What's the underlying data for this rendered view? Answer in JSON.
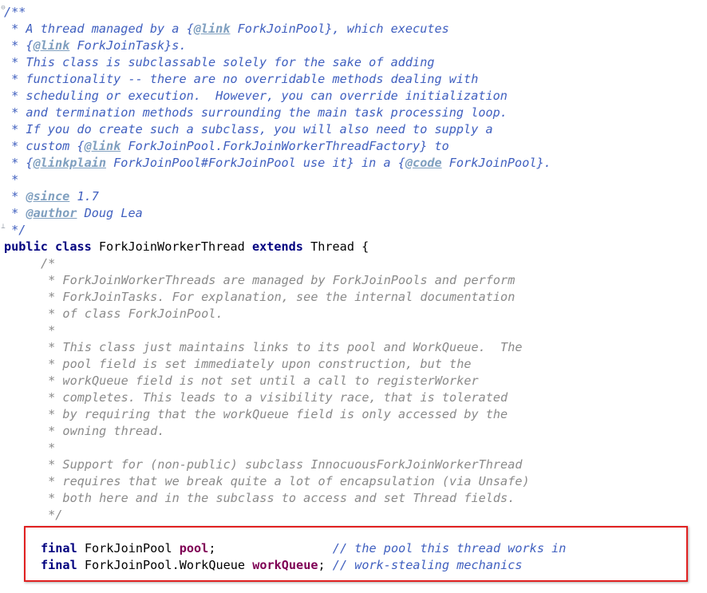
{
  "javadoc": {
    "open": "/**",
    "l1_a": " * A thread managed by a {",
    "l1_tag": "@link",
    "l1_b": " ForkJoinPool}, which executes",
    "l2_a": " * {",
    "l2_tag": "@link",
    "l2_b": " ForkJoinTask}s.",
    "l3": " * This class is subclassable solely for the sake of adding",
    "l4": " * functionality -- there are no overridable methods dealing with",
    "l5": " * scheduling or execution.  However, you can override initialization",
    "l6": " * and termination methods surrounding the main task processing loop.",
    "l7": " * If you do create such a subclass, you will also need to supply a",
    "l8_a": " * custom {",
    "l8_tag": "@link",
    "l8_b": " ForkJoinPool.ForkJoinWorkerThreadFactory} to",
    "l9_a": " * {",
    "l9_tag": "@linkplain",
    "l9_b": " ForkJoinPool#ForkJoinPool use it} in a {",
    "l9_tag2": "@code",
    "l9_c": " ForkJoinPool}.",
    "l10": " *",
    "l11_a": " * ",
    "l11_tag": "@since",
    "l11_b": " 1.7",
    "l12_a": " * ",
    "l12_tag": "@author",
    "l12_b": " Doug Lea",
    "close": " */"
  },
  "class_decl": {
    "kw_public": "public",
    "kw_class": "class",
    "name": "ForkJoinWorkerThread",
    "kw_extends": "extends",
    "super": "Thread {"
  },
  "block_comment": [
    "/*",
    " * ForkJoinWorkerThreads are managed by ForkJoinPools and perform",
    " * ForkJoinTasks. For explanation, see the internal documentation",
    " * of class ForkJoinPool.",
    " *",
    " * This class just maintains links to its pool and WorkQueue.  The",
    " * pool field is set immediately upon construction, but the",
    " * workQueue field is not set until a call to registerWorker",
    " * completes. This leads to a visibility race, that is tolerated",
    " * by requiring that the workQueue field is only accessed by the",
    " * owning thread.",
    " *",
    " * Support for (non-public) subclass InnocuousForkJoinWorkerThread",
    " * requires that we break quite a lot of encapsulation (via Unsafe)",
    " * both here and in the subclass to access and set Thread fields.",
    " */"
  ],
  "fields": [
    {
      "kw": "final",
      "type": "ForkJoinPool ",
      "name": "pool",
      "punct": ";",
      "pad": "                ",
      "comment": "// the pool this thread works in"
    },
    {
      "kw": "final",
      "type": "ForkJoinPool.WorkQueue ",
      "name": "workQueue",
      "punct": ";",
      "pad": " ",
      "comment": "// work-stealing mechanics"
    }
  ],
  "folding": {
    "fold_open_glyph": "⊖",
    "fold_close_glyph": "⊥"
  }
}
